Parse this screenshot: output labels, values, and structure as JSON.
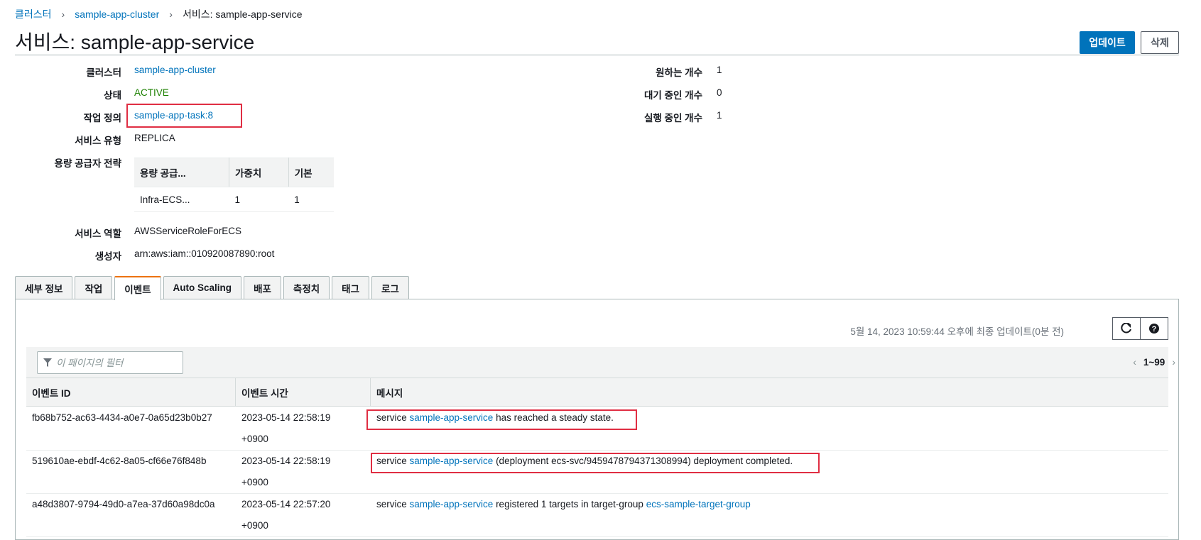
{
  "breadcrumb": {
    "clusters": "클러스터",
    "cluster": "sample-app-cluster",
    "current": "서비스: sample-app-service"
  },
  "page": {
    "title": "서비스: sample-app-service",
    "update_button": "업데이트",
    "delete_button": "삭제"
  },
  "details": {
    "cluster_label": "클러스터",
    "cluster_value": "sample-app-cluster",
    "status_label": "상태",
    "status_value": "ACTIVE",
    "taskdef_label": "작업 정의",
    "taskdef_value": "sample-app-task:8",
    "service_type_label": "서비스 유형",
    "service_type_value": "REPLICA",
    "capacity_label": "용량 공급자 전략",
    "capacity_table": {
      "headers": [
        "용량 공급...",
        "가중치",
        "기본"
      ],
      "row": [
        "Infra-ECS...",
        "1",
        "1"
      ]
    },
    "service_role_label": "서비스 역할",
    "service_role_value": "AWSServiceRoleForECS",
    "creator_label": "생성자",
    "creator_value": "arn:aws:iam::010920087890:root",
    "desired_label": "원하는 개수",
    "desired_value": "1",
    "pending_label": "대기 중인 개수",
    "pending_value": "0",
    "running_label": "실행 중인 개수",
    "running_value": "1"
  },
  "tabs": [
    "세부 정보",
    "작업",
    "이벤트",
    "Auto Scaling",
    "배포",
    "측정치",
    "태그",
    "로그"
  ],
  "active_tab": "이벤트",
  "events": {
    "last_updated": "5월 14, 2023 10:59:44 오후에 최종 업데이트(0분 전)",
    "filter_placeholder": "이 페이지의 필터",
    "pager": "1~99",
    "columns": [
      "이벤트 ID",
      "이벤트 시간",
      "메시지"
    ],
    "rows": [
      {
        "id": "fb68b752-ac63-4434-a0e7-0a65d23b0b27",
        "time_date": "2023-05-14 22:58:19",
        "time_tz": "+0900",
        "msg_pre": "service ",
        "msg_link": "sample-app-service",
        "msg_post": " has reached a steady state.",
        "msg_link2": ""
      },
      {
        "id": "519610ae-ebdf-4c62-8a05-cf66e76f848b",
        "time_date": "2023-05-14 22:58:19",
        "time_tz": "+0900",
        "msg_pre": "service ",
        "msg_link": "sample-app-service",
        "msg_post": " (deployment ecs-svc/9459478794371308994) deployment completed.",
        "msg_link2": ""
      },
      {
        "id": "a48d3807-9794-49d0-a7ea-37d60a98dc0a",
        "time_date": "2023-05-14 22:57:20",
        "time_tz": "+0900",
        "msg_pre": "service ",
        "msg_link": "sample-app-service",
        "msg_post": " registered 1 targets in target-group ",
        "msg_link2": "ecs-sample-target-group"
      }
    ]
  },
  "colors": {
    "accent": "#0073bb",
    "active_status": "#1d8102",
    "active_tab_border": "#ec7211",
    "highlight_box": "#e02e43"
  },
  "icons": {
    "refresh": "refresh-icon",
    "help": "help-icon",
    "filter": "filter-icon",
    "prev": "chevron-left-icon",
    "next": "chevron-right-icon",
    "breadcrumb_sep": "chevron-right-icon"
  }
}
